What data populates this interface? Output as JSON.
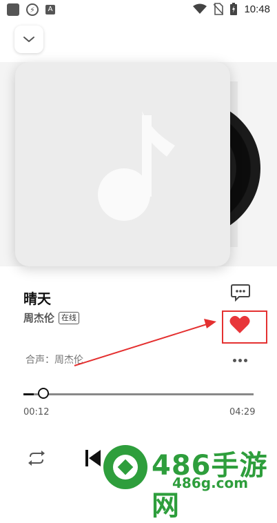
{
  "status_bar": {
    "time": "10:48",
    "left_icons": [
      "square-icon",
      "lightning-icon",
      "a-icon"
    ],
    "right_icons": [
      "wifi-icon",
      "no-sim-icon",
      "battery-icon"
    ]
  },
  "header": {
    "collapse_icon": "chevron-down-icon"
  },
  "song": {
    "title": "晴天",
    "artist": "周杰伦",
    "badge": "在线",
    "chorus": "合声：周杰伦"
  },
  "actions": {
    "comment_icon": "comment-icon",
    "like_icon": "heart-icon",
    "like_color": "#e8363a",
    "more_icon": "more-icon"
  },
  "progress": {
    "elapsed": "00:12",
    "total": "04:29",
    "fraction": 0.045
  },
  "controls": {
    "repeat_icon": "repeat-icon",
    "prev_icon": "previous-icon"
  },
  "watermark": {
    "text": "486手游网",
    "sub": "486g.com"
  },
  "colors": {
    "accent": "#111111",
    "annotation": "#e43030",
    "watermark": "#2e9e3c"
  }
}
